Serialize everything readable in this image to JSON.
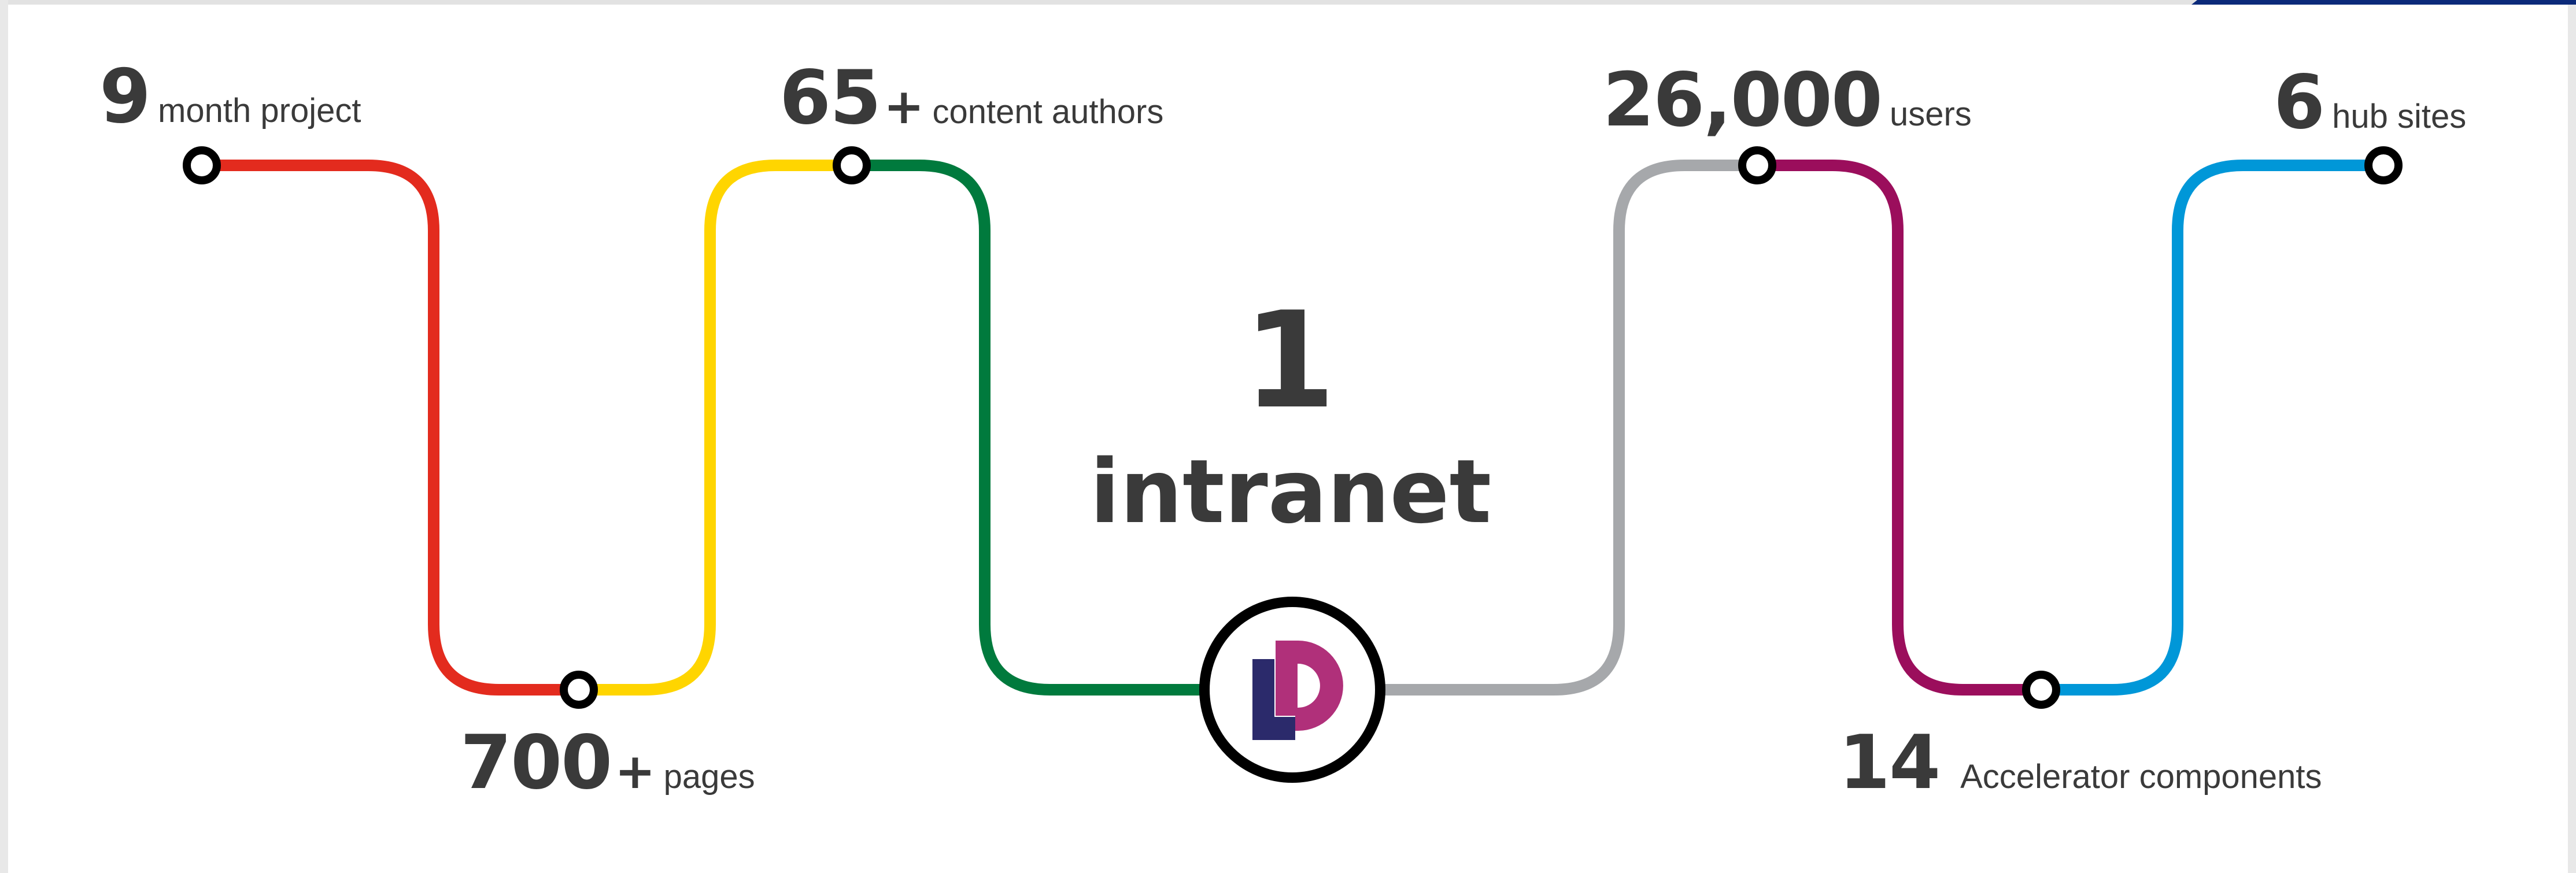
{
  "stats": {
    "months": {
      "number": "9",
      "label": "month project"
    },
    "pages": {
      "number": "700",
      "suffix": "+",
      "label": "pages"
    },
    "authors": {
      "number": "65",
      "suffix": "+",
      "label": "content authors"
    },
    "users": {
      "number": "26,000",
      "label": "users"
    },
    "components": {
      "number": "14",
      "label": "Accelerator components"
    },
    "hubs": {
      "number": "6",
      "label": "hub sites"
    }
  },
  "center": {
    "number": "1",
    "word": "intranet"
  },
  "colors": {
    "red": "#e32b1e",
    "yellow": "#ffd500",
    "green": "#007a3d",
    "grey": "#a6a8ab",
    "magenta": "#9b0e5c",
    "blue": "#0097d8",
    "text": "#3a3a3a",
    "logo_navy": "#2b2a6b",
    "logo_pink": "#b0307a",
    "corner_accent": "#0b2a7a"
  },
  "logo": {
    "icon": "dp-logo-icon"
  }
}
